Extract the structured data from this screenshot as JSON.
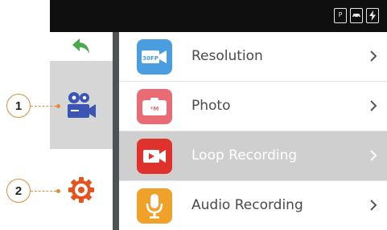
{
  "status_bar": {
    "icons": [
      {
        "name": "parking-mode-icon",
        "text": "P"
      },
      {
        "name": "car-mode-icon",
        "text": ""
      },
      {
        "name": "battery-charging-icon",
        "text": ""
      }
    ]
  },
  "sidebar": {
    "back": {
      "icon": "back-arrow-icon",
      "color": "#49a94b"
    },
    "items": [
      {
        "name": "video",
        "icon": "video-camera-icon",
        "color": "#3b55b5",
        "selected": true
      },
      {
        "name": "settings",
        "icon": "gear-icon",
        "color": "#e5531f",
        "selected": false
      }
    ]
  },
  "menu": {
    "items": [
      {
        "label": "Resolution",
        "icon": "resolution-icon",
        "icon_text": "30FP",
        "color": "#4a9ee0",
        "selected": false
      },
      {
        "label": "Photo",
        "icon": "photo-camera-icon",
        "icon_text": "*M",
        "color": "#e96c74",
        "selected": false
      },
      {
        "label": "Loop Recording",
        "icon": "loop-recording-icon",
        "icon_text": "",
        "color": "#e0322c",
        "selected": true
      },
      {
        "label": "Audio Recording",
        "icon": "microphone-icon",
        "icon_text": "",
        "color": "#f0a12a",
        "selected": false
      }
    ]
  },
  "callouts": [
    {
      "number": "1"
    },
    {
      "number": "2"
    }
  ],
  "colors": {
    "accent_orange": "#e08a3a",
    "selected_row": "#cfcfcf"
  }
}
